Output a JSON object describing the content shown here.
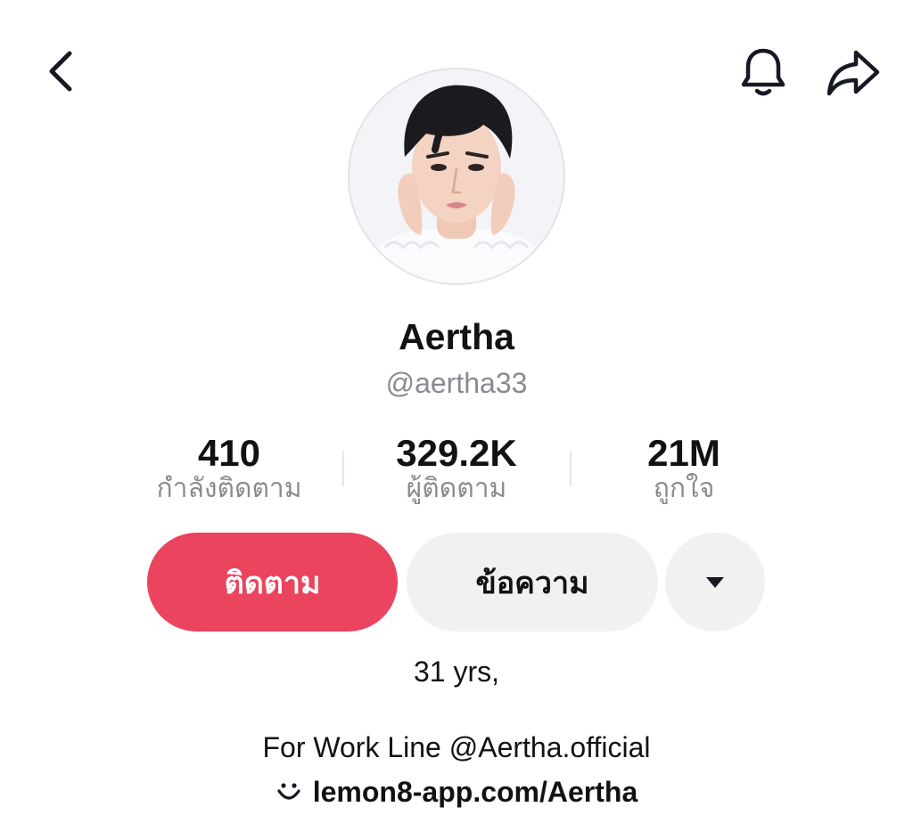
{
  "header": {
    "back_icon": "chevron-left-icon",
    "bell_icon": "bell-icon",
    "share_icon": "share-arrow-icon"
  },
  "profile": {
    "display_name": "Aertha",
    "username": "@aertha33"
  },
  "stats": [
    {
      "value": "410",
      "label": "กำลังติดตาม"
    },
    {
      "value": "329.2K",
      "label": "ผู้ติดตาม"
    },
    {
      "value": "21M",
      "label": "ถูกใจ"
    }
  ],
  "actions": {
    "follow_label": "ติดตาม",
    "message_label": "ข้อความ",
    "more_icon": "caret-down-icon"
  },
  "bio": {
    "age_line": "31 yrs,",
    "work_line": "For Work Line @Aertha.official",
    "link_icon": "lemon8-smile-icon",
    "link_text": "lemon8-app.com/Aertha"
  },
  "colors": {
    "follow_button": "#ea445e",
    "secondary_button": "#f1f1f2",
    "muted_text": "#8a8b91"
  }
}
